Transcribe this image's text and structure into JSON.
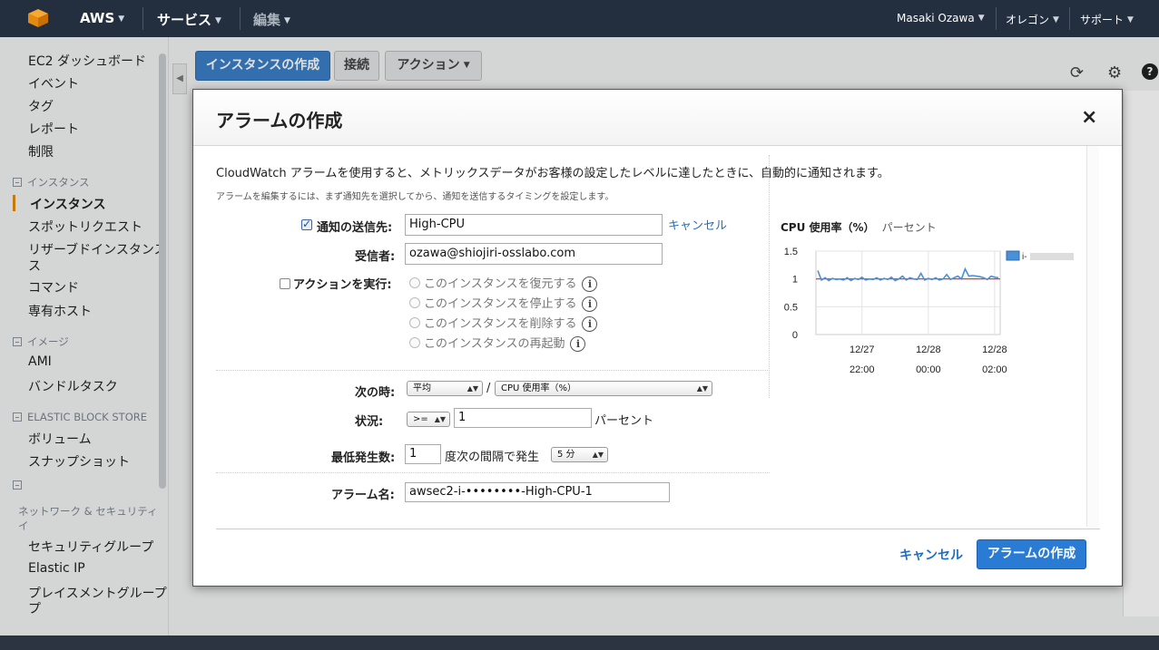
{
  "topnav": {
    "brand": "AWS",
    "services": "サービス",
    "edit": "編集",
    "user": "Masaki Ozawa",
    "region": "オレゴン",
    "support": "サポート"
  },
  "sidebar": {
    "items": [
      "EC2 ダッシュボード",
      "イベント",
      "タグ",
      "レポート",
      "制限"
    ],
    "group_instances": "インスタンス",
    "instances_items": [
      "インスタンス",
      "スポットリクエスト",
      "リザーブドインスタンス",
      "コマンド",
      "専有ホスト"
    ],
    "group_images": "イメージ",
    "images_items": [
      "AMI",
      "バンドルタスク"
    ],
    "group_ebs": "ELASTIC BLOCK STORE",
    "ebs_items": [
      "ボリューム",
      "スナップショット"
    ],
    "group_network": "ネットワーク & セキュリティ",
    "network_items": [
      "セキュリティグループ",
      "Elastic IP",
      "プレイスメントグループ"
    ],
    "network_item_wrap": "プ",
    "reserved_wrap": "ス"
  },
  "toolbar": {
    "launch": "インスタンスの作成",
    "connect": "接続",
    "actions": "アクション"
  },
  "modal": {
    "title": "アラームの作成",
    "close": "×",
    "description": "CloudWatch アラームを使用すると、メトリックスデータがお客様の設定したレベルに達したときに、自動的に通知されます。",
    "subdescription": "アラームを編集するには、まず通知先を選択してから、通知を送信するタイミングを設定します。",
    "notify_label": "通知の送信先:",
    "notify_value": "High-CPU",
    "notify_cancel": "キャンセル",
    "recipient_label": "受信者:",
    "recipient_value": "ozawa@shiojiri-osslabo.com",
    "action_label": "アクションを実行:",
    "actions": [
      "このインスタンスを復元する",
      "このインスタンスを停止する",
      "このインスタンスを削除する",
      "このインスタンスの再起動"
    ],
    "when_label": "次の時:",
    "stat_select": "平均",
    "metric_select": "CPU 使用率（%）",
    "status_label": "状況:",
    "operator_select": ">=",
    "threshold_value": "1",
    "threshold_unit": "パーセント",
    "min_label": "最低発生数:",
    "min_value": "1",
    "period_text": "度次の間隔で発生",
    "period_select": "5 分",
    "name_label": "アラーム名:",
    "name_value": "awsec2-i-••••••••-High-CPU-1",
    "cancel_button": "キャンセル",
    "create_button": "アラームの作成"
  },
  "chart_data": {
    "type": "line",
    "title": "CPU 使用率（%）",
    "ylabel": "パーセント",
    "ylim": [
      0,
      1.5
    ],
    "yticks": [
      "1.5",
      "1",
      "0.5",
      "0"
    ],
    "xticks": [
      {
        "date": "12/27",
        "time": "22:00"
      },
      {
        "date": "12/28",
        "time": "00:00"
      },
      {
        "date": "12/28",
        "time": "02:00"
      }
    ],
    "threshold": 1,
    "legend": "i-",
    "series": [
      {
        "values": [
          1.15,
          0.98,
          1.02,
          0.97,
          1.01,
          0.99,
          1.0,
          0.98,
          1.02,
          0.97,
          1.01,
          0.99,
          1.03,
          0.98,
          1.0,
          0.99,
          1.02,
          0.98,
          1.01,
          0.99,
          1.03,
          0.97,
          1.0,
          1.05,
          0.98,
          1.02,
          1.0,
          0.99,
          1.1,
          0.98,
          1.01,
          0.99,
          1.02,
          0.98,
          1.0,
          1.08,
          0.99,
          1.02,
          1.05,
          1.0,
          1.18,
          1.05,
          1.06,
          1.05,
          1.04,
          1.02,
          0.99,
          1.05,
          1.03,
          1.02
        ]
      }
    ],
    "colors": {
      "series": "#4a90d9",
      "threshold": "#d62c2c"
    }
  }
}
